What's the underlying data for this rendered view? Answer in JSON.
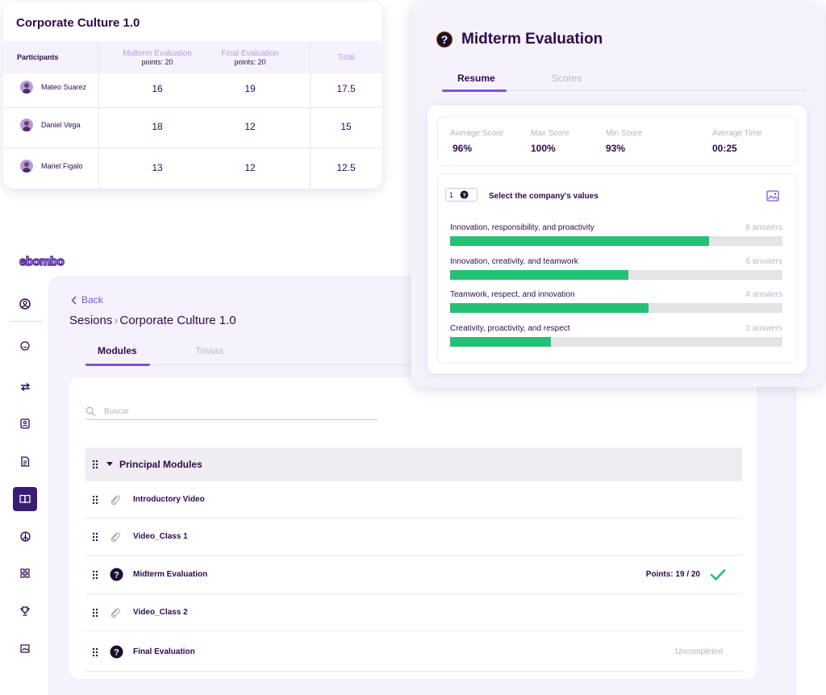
{
  "results_table": {
    "title": "Corporate Culture 1.0",
    "columns": {
      "participants": "Participants",
      "midterm": "Midterm Evaluation",
      "midterm_points": "points: 20",
      "final": "Final Evaluation",
      "final_points": "points: 20",
      "total": "Total"
    },
    "rows": [
      {
        "name": "Mateo Suarez",
        "midterm": "16",
        "final": "19",
        "total": "17.5"
      },
      {
        "name": "Daniel Vega",
        "midterm": "18",
        "final": "12",
        "total": "15"
      },
      {
        "name": "Mariel Figalo",
        "midterm": "13",
        "final": "12",
        "total": "12.5"
      }
    ]
  },
  "app": {
    "logo": "ebombo",
    "back_label": "Back",
    "breadcrumb": {
      "parent": "Sesions",
      "sep": "›",
      "current": "Corporate Culture 1.0"
    },
    "tabs": [
      {
        "label": "Modules",
        "active": true
      },
      {
        "label": "Trivias",
        "active": false
      }
    ],
    "search": {
      "placeholder": "Buscar"
    },
    "group": {
      "label": "Principal Modules"
    },
    "modules": [
      {
        "label": "Introductory Video",
        "icon": "paperclip-icon"
      },
      {
        "label": "Video_Class 1",
        "icon": "paperclip-icon"
      },
      {
        "label": "Midterm Evaluation",
        "icon": "question-icon",
        "points": "Points: 19 / 20",
        "status": "completed"
      },
      {
        "label": "Video_Class 2",
        "icon": "paperclip-icon"
      },
      {
        "label": "Final Evaluation",
        "icon": "question-icon",
        "status_label": "Uncompleted"
      }
    ],
    "sidebar_icons": [
      "user-circle-icon",
      "smiley-icon",
      "transfer-icon",
      "contact-card-icon",
      "document-icon",
      "book-icon",
      "peace-icon",
      "grid-icon",
      "trophy-icon",
      "image-frame-icon"
    ],
    "active_sidebar": "book-icon"
  },
  "evaluation": {
    "title": "Midterm Evaluation",
    "tabs": [
      {
        "label": "Resume",
        "active": true
      },
      {
        "label": "Scores",
        "active": false
      }
    ],
    "stats": [
      {
        "label": "Average Score",
        "value": "96%"
      },
      {
        "label": "Max Score",
        "value": "100%"
      },
      {
        "label": "Min Score",
        "value": "93%"
      },
      {
        "label": "Average Time",
        "value": "00:25"
      }
    ],
    "question": {
      "number": "1",
      "text": "Select the company's values",
      "answers": [
        {
          "label": "Innovation, responsibility, and proactivity",
          "count": "8 answers",
          "fraction": 0.78
        },
        {
          "label": "Innovation, creativity, and teamwork",
          "count": "6 answers",
          "fraction": 0.537
        },
        {
          "label": "Teamwork, respect, and innovation",
          "count": "4 answers",
          "fraction": 0.597
        },
        {
          "label": "Creativity, proactivity, and respect",
          "count": "2 answers",
          "fraction": 0.303
        }
      ]
    }
  },
  "colors": {
    "accent": "#7c55d6",
    "dark": "#2f0a4e",
    "success": "#26c074",
    "panel": "#f6f2fd"
  }
}
